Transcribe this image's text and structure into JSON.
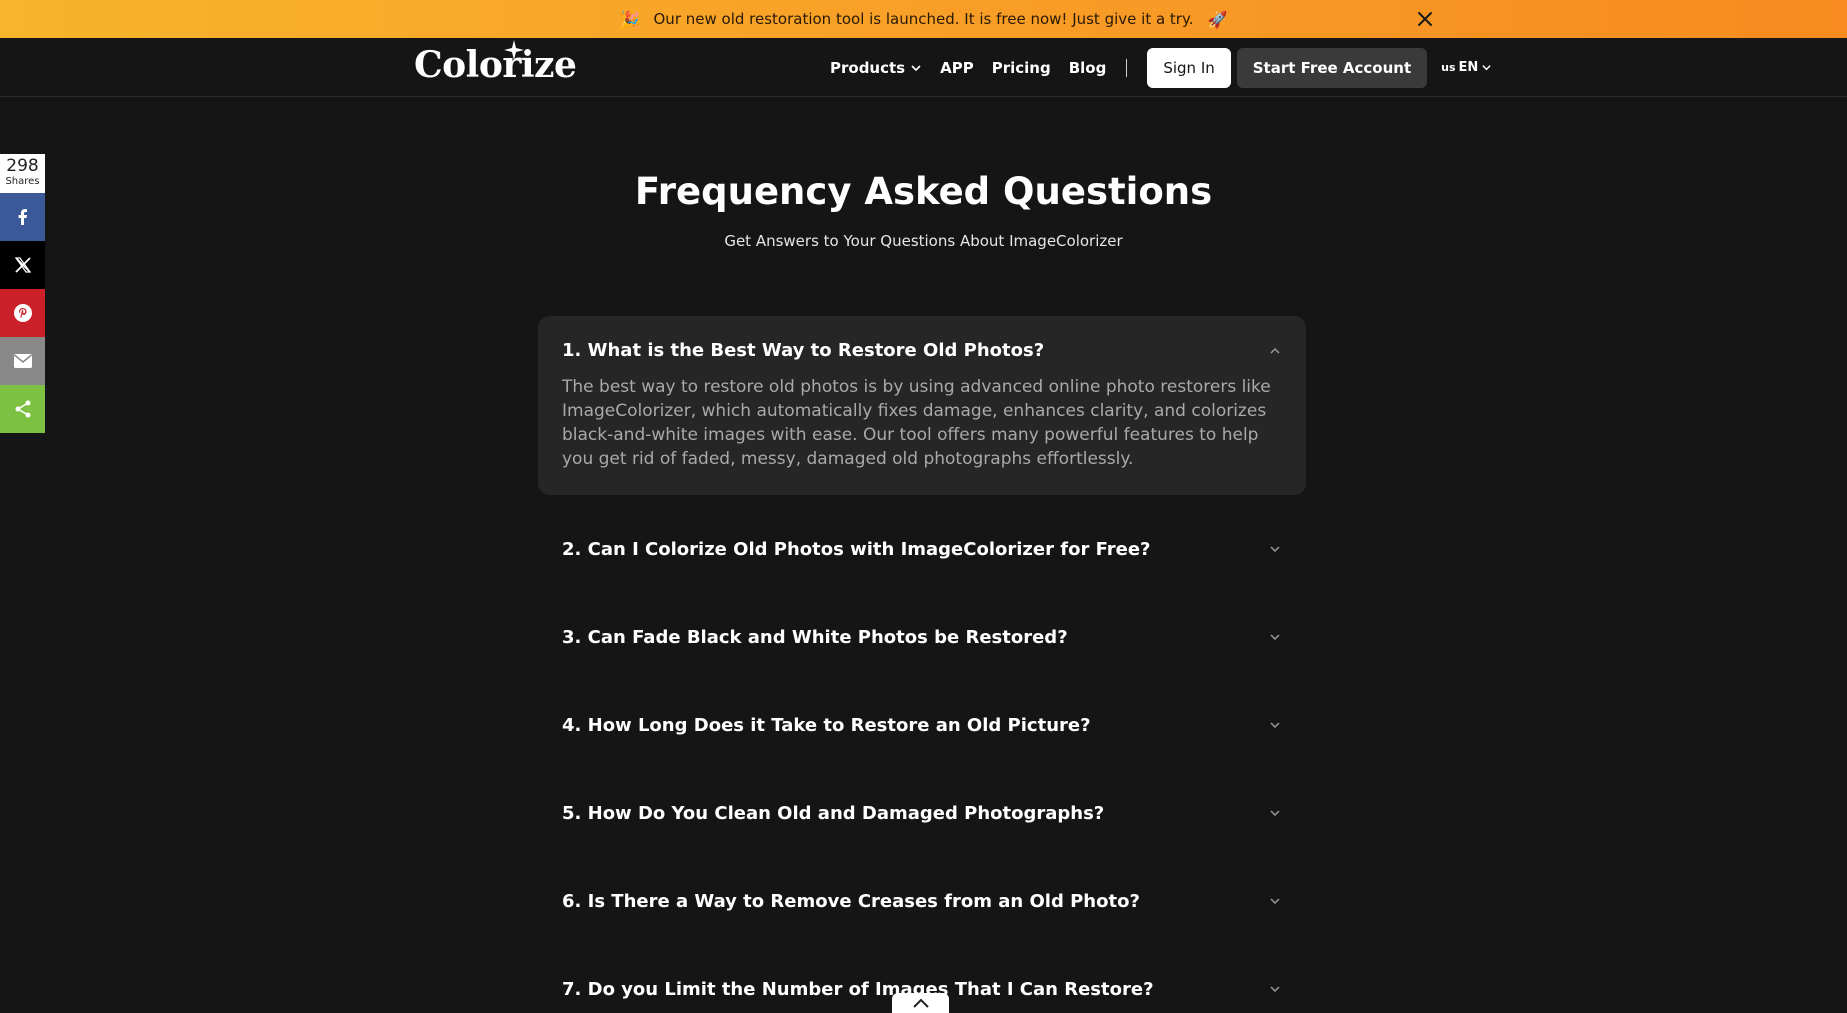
{
  "banner": {
    "message": "Our new old restoration tool is launched. It is free now! Just give it a try.",
    "party_emoji": "🎉",
    "rocket_emoji": "🚀",
    "color_start": "#f7b42c",
    "color_end": "#f78b1f"
  },
  "nav": {
    "logo": "Colorize",
    "links": [
      "Products",
      "APP",
      "Pricing",
      "Blog"
    ],
    "signin_label": "Sign In",
    "start_label": "Start Free Account",
    "lang_flag": "us",
    "lang_code": "EN"
  },
  "share": {
    "count": "298",
    "count_label": "Shares",
    "buttons": [
      {
        "name": "facebook",
        "color": "#3b5998"
      },
      {
        "name": "x-twitter",
        "color": "#000000"
      },
      {
        "name": "pinterest",
        "color": "#cb2027"
      },
      {
        "name": "email",
        "color": "#888888"
      },
      {
        "name": "share",
        "color": "#7dc142"
      }
    ]
  },
  "page": {
    "title": "Frequency Asked Questions",
    "subtitle": "Get Answers to Your Questions About ImageColorizer"
  },
  "faq": {
    "items": [
      {
        "question": "1. What is the Best Way to Restore Old Photos?",
        "answer": "The best way to restore old photos is by using advanced online photo restorers like ImageColorizer, which automatically fixes damage, enhances clarity, and colorizes black-and-white images with ease. Our tool offers many powerful features to help you get rid of faded, messy, damaged old photographs effortlessly.",
        "expanded": true
      },
      {
        "question": "2. Can I Colorize Old Photos with ImageColorizer for Free?",
        "expanded": false
      },
      {
        "question": "3. Can Fade Black and White Photos be Restored?",
        "expanded": false
      },
      {
        "question": "4. How Long Does it Take to Restore an Old Picture?",
        "expanded": false
      },
      {
        "question": "5. How Do You Clean Old and Damaged Photographs?",
        "expanded": false
      },
      {
        "question": "6. Is There a Way to Remove Creases from an Old Photo?",
        "expanded": false
      },
      {
        "question": "7. Do you Limit the Number of Images That I Can Restore?",
        "expanded": false
      }
    ]
  }
}
